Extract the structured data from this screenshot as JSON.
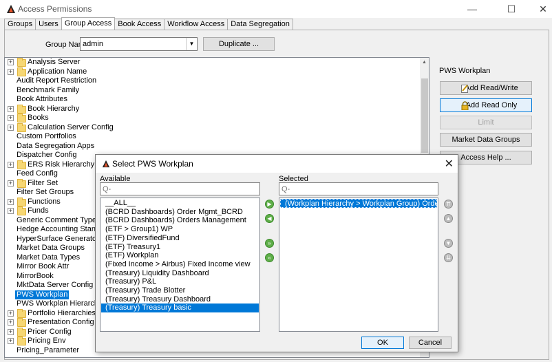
{
  "window": {
    "title": "Access Permissions",
    "minimize": "—",
    "maximize": "☐",
    "close": "✕"
  },
  "tabs": [
    {
      "label": "Groups"
    },
    {
      "label": "Users"
    },
    {
      "label": "Group Access",
      "active": true
    },
    {
      "label": "Book Access"
    },
    {
      "label": "Workflow Access"
    },
    {
      "label": "Data Segregation"
    }
  ],
  "group": {
    "label": "Group Name",
    "value": "admin",
    "duplicate_label": "Duplicate ..."
  },
  "tree": [
    {
      "label": "Analysis Server",
      "expandable": true,
      "folder": true
    },
    {
      "label": "Application Name",
      "expandable": true,
      "folder": true
    },
    {
      "label": "Audit Report Restriction"
    },
    {
      "label": "Benchmark Family"
    },
    {
      "label": "Book Attributes"
    },
    {
      "label": "Book Hierarchy",
      "expandable": true,
      "folder": true
    },
    {
      "label": "Books",
      "expandable": true,
      "folder": true
    },
    {
      "label": "Calculation Server Config",
      "expandable": true,
      "folder": true
    },
    {
      "label": "Custom Portfolios"
    },
    {
      "label": "Data Segregation Apps"
    },
    {
      "label": "Dispatcher Config"
    },
    {
      "label": "ERS Risk Hierarchy",
      "expandable": true,
      "folder": true
    },
    {
      "label": "Feed Config"
    },
    {
      "label": "Filter Set",
      "expandable": true,
      "folder": true
    },
    {
      "label": "Filter Set Groups"
    },
    {
      "label": "Functions",
      "expandable": true,
      "folder": true
    },
    {
      "label": "Funds",
      "expandable": true,
      "folder": true
    },
    {
      "label": "Generic Comment Type"
    },
    {
      "label": "Hedge Accounting Standard"
    },
    {
      "label": "HyperSurface Generators"
    },
    {
      "label": "Market Data Groups"
    },
    {
      "label": "Market Data Types"
    },
    {
      "label": "Mirror Book Attr"
    },
    {
      "label": "MirrorBook"
    },
    {
      "label": "MktData Server Config"
    },
    {
      "label": "PWS Workplan",
      "selected": true
    },
    {
      "label": "PWS Workplan Hierarchy"
    },
    {
      "label": "Portfolio Hierarchies",
      "expandable": true,
      "folder": true
    },
    {
      "label": "Presentation Config",
      "expandable": true,
      "folder": true
    },
    {
      "label": "Pricer Config",
      "expandable": true,
      "folder": true
    },
    {
      "label": "Pricing Env",
      "expandable": true,
      "folder": true
    },
    {
      "label": "Pricing_Parameter"
    }
  ],
  "right_panel": {
    "title": "PWS Workplan",
    "add_read_write": "Add Read/Write",
    "add_read_only": "Add Read Only",
    "limit": "Limit",
    "market_data_groups": "Market Data Groups",
    "access_help": "Access Help ..."
  },
  "dialog": {
    "title": "Select PWS Workplan",
    "available_label": "Available",
    "selected_label": "Selected",
    "search_placeholder": "Q-",
    "available_items": [
      "__ALL__",
      "(BCRD Dashboards) Order Mgmt_BCRD",
      "(BCRD Dashboards) Orders Management",
      "(ETF > Group1) WP",
      "(ETF) DiversifiedFund",
      "(ETF) Treasury1",
      "(ETF) Workplan",
      "(Fixed Income > Airbus) Fixed Income view",
      "(Treasury) Liquidity Dashboard",
      "(Treasury) P&L",
      "(Treasury) Trade Blotter",
      "(Treasury) Treasury Dashboard",
      "(Treasury) Treasury basic"
    ],
    "available_selected_index": 12,
    "selected_items": [
      "(Workplan Hierarchy > Workplan Group) Order View"
    ],
    "ok_label": "OK",
    "cancel_label": "Cancel"
  },
  "colors": {
    "selection": "#0078d7",
    "accent_green": "#5fae49",
    "folder": "#f6d774"
  }
}
